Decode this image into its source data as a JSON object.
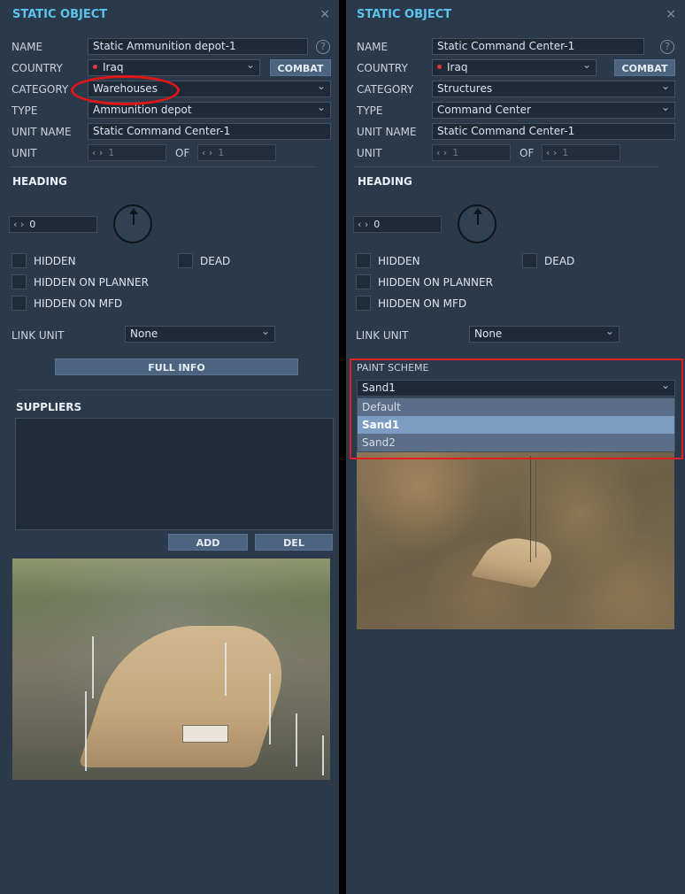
{
  "left": {
    "title": "STATIC OBJECT",
    "close": "×",
    "help": "?",
    "labels": {
      "name": "NAME",
      "country": "COUNTRY",
      "category": "CATEGORY",
      "type": "TYPE",
      "unit_name": "UNIT NAME",
      "unit": "UNIT",
      "of": "OF"
    },
    "name_value": "Static Ammunition depot-1",
    "country_value": "Iraq",
    "combat_label": "COMBAT",
    "category_value": "Warehouses",
    "type_value": "Ammunition depot",
    "unit_name_value": "Static Command Center-1",
    "unit_value": "1",
    "of_value": "1",
    "heading_title": "HEADING",
    "heading_value": "0",
    "checkboxes": {
      "hidden": "HIDDEN",
      "dead": "DEAD",
      "hidden_planner": "HIDDEN ON PLANNER",
      "hidden_mfd": "HIDDEN ON MFD"
    },
    "link_unit_label": "LINK UNIT",
    "link_unit_value": "None",
    "full_info_label": "FULL INFO",
    "suppliers_title": "SUPPLIERS",
    "add_label": "ADD",
    "del_label": "DEL"
  },
  "right": {
    "title": "STATIC OBJECT",
    "close": "×",
    "help": "?",
    "labels": {
      "name": "NAME",
      "country": "COUNTRY",
      "category": "CATEGORY",
      "type": "TYPE",
      "unit_name": "UNIT NAME",
      "unit": "UNIT",
      "of": "OF"
    },
    "name_value": "Static Command Center-1",
    "country_value": "Iraq",
    "combat_label": "COMBAT",
    "category_value": "Structures",
    "type_value": "Command Center",
    "unit_name_value": "Static Command Center-1",
    "unit_value": "1",
    "of_value": "1",
    "heading_title": "HEADING",
    "heading_value": "0",
    "checkboxes": {
      "hidden": "HIDDEN",
      "dead": "DEAD",
      "hidden_planner": "HIDDEN ON PLANNER",
      "hidden_mfd": "HIDDEN ON MFD"
    },
    "link_unit_label": "LINK UNIT",
    "link_unit_value": "None",
    "paint_scheme_label": "PAINT SCHEME",
    "paint_scheme_value": "Sand1",
    "paint_scheme_options": [
      "Default",
      "Sand1",
      "Sand2"
    ]
  },
  "colors": {
    "panel_bg": "#2a3a4b",
    "title": "#5cc3ee",
    "highlight": "#e01515",
    "button": "#4c6480",
    "selected_option": "#7d9cc4"
  },
  "icons": {
    "spin_arrows": "‹ ›",
    "dropdown": "chevron-down-icon",
    "country_dot": "red-dot-icon"
  }
}
